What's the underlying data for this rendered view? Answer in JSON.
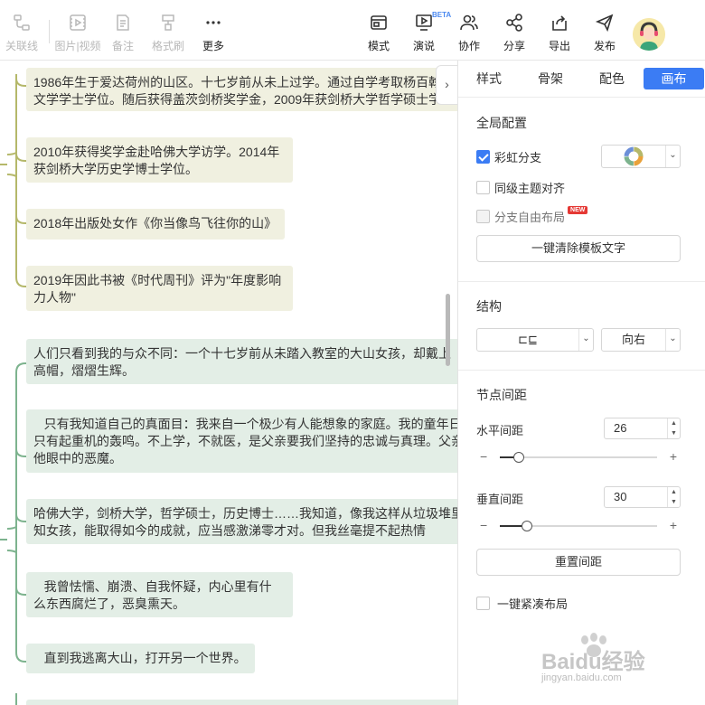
{
  "toolbar": {
    "left_buttons": [
      {
        "label": "关联线",
        "icon": "relation-line-icon",
        "disabled": true
      },
      {
        "label": "图片|视频",
        "icon": "media-icon",
        "disabled": true
      },
      {
        "label": "备注",
        "icon": "note-icon",
        "disabled": true
      },
      {
        "label": "格式刷",
        "icon": "format-brush-icon",
        "disabled": true
      },
      {
        "label": "更多",
        "icon": "more-icon",
        "disabled": false
      }
    ],
    "right_buttons": [
      {
        "label": "模式",
        "icon": "mode-icon"
      },
      {
        "label": "演说",
        "icon": "present-icon"
      },
      {
        "label": "协作",
        "icon": "collaborate-icon"
      },
      {
        "label": "分享",
        "icon": "share-icon"
      },
      {
        "label": "导出",
        "icon": "export-icon"
      },
      {
        "label": "发布",
        "icon": "publish-icon"
      }
    ],
    "beta_badge": "BETA"
  },
  "canvas": {
    "nodes_olive": [
      "1986年生于爱达荷州的山区。十七岁前从未上过学。通过自学考取杨百翰\n文学学士学位。随后获得盖茨剑桥奖学金，2009年获剑桥大学哲学硕士学",
      "2010年获得奖学金赴哈佛大学访学。2014年\n获剑桥大学历史学博士学位。",
      "2018年出版处女作《你当像鸟飞往你的山》",
      "2019年因此书被《时代周刊》评为\"年度影响\n力人物\""
    ],
    "nodes_green": [
      "人们只看到我的与众不同：一个十七岁前从未踏入教室的大山女孩，却戴上\n高帽，熠熠生辉。",
      "   只有我知道自己的真面目：我来自一个极少有人能想象的家庭。我的童年日\n只有起重机的轰鸣。不上学，不就医，是父亲要我们坚持的忠诚与真理。父亲\n他眼中的恶魔。",
      "哈佛大学，剑桥大学，哲学硕士，历史博士……我知道，像我这样从垃圾堆里\n知女孩，能取得如今的成就，应当感激涕零才对。但我丝毫提不起热情",
      "   我曾怯懦、崩溃、自我怀疑，内心里有什\n么东西腐烂了，恶臭熏天。",
      "   直到我逃离大山，打开另一个世界。"
    ],
    "colors": {
      "olive_branch": "#b5b86a",
      "green_branch": "#7db38e",
      "olive_node": "#f0f0e0",
      "green_node": "#e3eee6"
    }
  },
  "panel": {
    "tabs": [
      {
        "label": "样式",
        "active": false
      },
      {
        "label": "骨架",
        "active": false
      },
      {
        "label": "配色",
        "active": false
      },
      {
        "label": "画布",
        "active": true
      }
    ],
    "global_config": {
      "title": "全局配置",
      "rainbow_branch": {
        "label": "彩虹分支",
        "checked": true
      },
      "same_level_align": {
        "label": "同级主题对齐",
        "checked": false
      },
      "free_layout": {
        "label": "分支自由布局",
        "checked": false,
        "badge": "NEW"
      },
      "clear_template_button": "一键清除模板文字"
    },
    "structure": {
      "title": "结构",
      "layout_value": "⊏⊑",
      "direction_value": "向右"
    },
    "spacing": {
      "title": "节点间距",
      "horizontal": {
        "label": "水平间距",
        "value": "26",
        "slider_fraction": 0.12
      },
      "vertical": {
        "label": "垂直间距",
        "value": "30",
        "slider_fraction": 0.17
      },
      "reset_button": "重置间距",
      "compact_layout": {
        "label": "一键紧凑布局",
        "checked": false
      }
    }
  },
  "watermark": {
    "text": "Baidu经验",
    "subtext": "jingyan.baidu.com"
  },
  "accent_color": "#3b7cf4"
}
